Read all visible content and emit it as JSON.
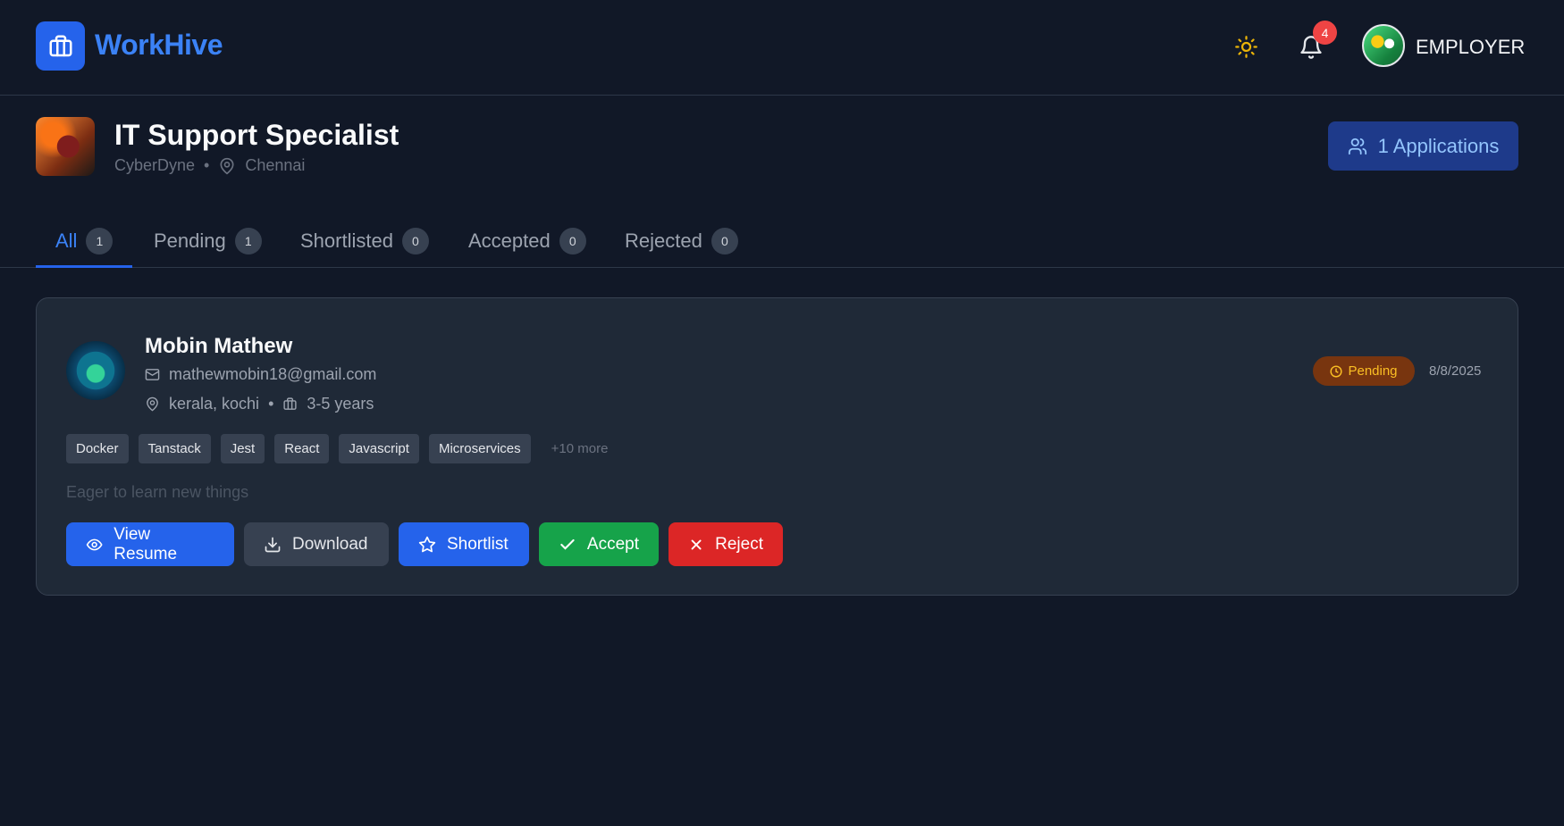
{
  "header": {
    "brand": "WorkHive",
    "notification_count": "4",
    "role": "EMPLOYER"
  },
  "job": {
    "title": "IT Support Specialist",
    "company": "CyberDyne",
    "separator": "•",
    "location": "Chennai",
    "applications_label": "1 Applications"
  },
  "tabs": [
    {
      "label": "All",
      "count": "1",
      "active": true
    },
    {
      "label": "Pending",
      "count": "1"
    },
    {
      "label": "Shortlisted",
      "count": "0"
    },
    {
      "label": "Accepted",
      "count": "0"
    },
    {
      "label": "Rejected",
      "count": "0"
    }
  ],
  "applicant": {
    "name": "Mobin Mathew",
    "email": "mathewmobin18@gmail.com",
    "location": "kerala, kochi",
    "separator": "•",
    "experience": "3-5 years",
    "status": "Pending",
    "applied_date": "8/8/2025",
    "skills": [
      "Docker",
      "Tanstack",
      "Jest",
      "React",
      "Javascript",
      "Microservices"
    ],
    "more_skills": "+10 more",
    "cover_note": "Eager to learn new things"
  },
  "actions": {
    "view_resume": "View Resume",
    "download": "Download",
    "shortlist": "Shortlist",
    "accept": "Accept",
    "reject": "Reject"
  },
  "colors": {
    "background": "#111827",
    "card": "#1f2937",
    "accent": "#2563eb",
    "pending": "#fbbf24",
    "accept": "#16a34a",
    "reject": "#dc2626"
  }
}
